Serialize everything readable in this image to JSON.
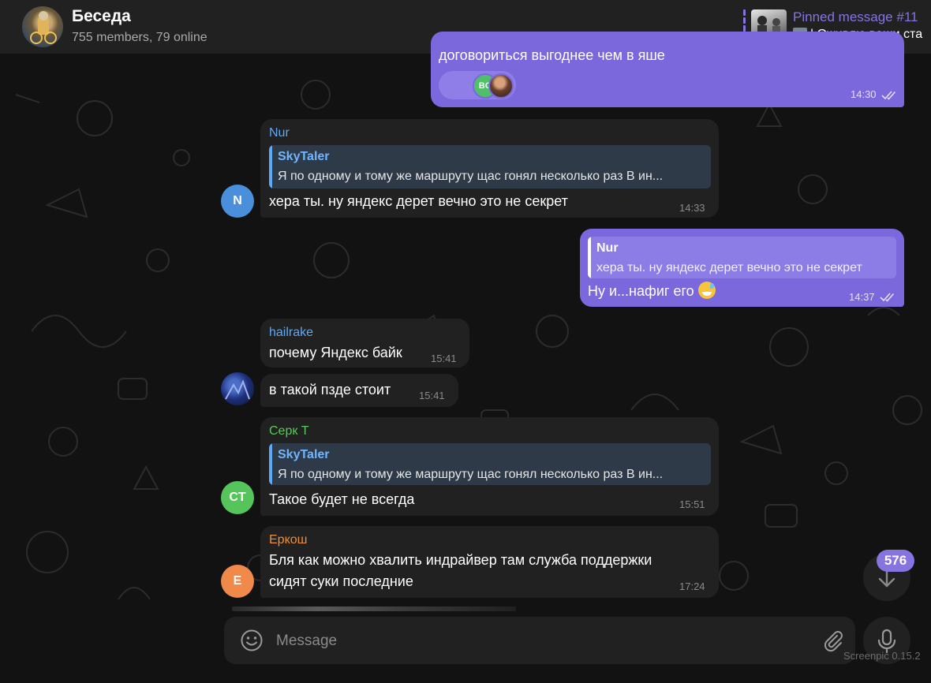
{
  "header": {
    "title": "Беседа",
    "subtitle": "755 members, 79 online",
    "pinned_title": "Pinned message #11",
    "pinned_text": "| Оживлю ваши ста"
  },
  "messages": [
    {
      "id": "m1",
      "direction": "out",
      "text": "договориться выгоднее чем в яше",
      "time": "14:30",
      "reactions": [
        {
          "label": "BG",
          "color": "#4fbf6a"
        },
        {
          "label": "",
          "type": "photo"
        }
      ]
    },
    {
      "id": "m2",
      "direction": "in",
      "sender": "Nur",
      "sender_color": "#5fa8f5",
      "avatar_initial": "N",
      "avatar_color": "#4a8fdc",
      "reply_name": "SkyTaler",
      "reply_text": "Я по одному и тому же маршруту щас гонял несколько раз В ин...",
      "text": "хера ты. ну яндекс дерет вечно это не секрет",
      "time": "14:33"
    },
    {
      "id": "m3",
      "direction": "out",
      "reply_name": "Nur",
      "reply_text": "хера ты. ну яндекс дерет вечно это не секрет",
      "text": "Ну и...нафиг его",
      "time": "14:37"
    },
    {
      "id": "m4",
      "direction": "in",
      "sender": "hailrake",
      "sender_color": "#5fa8f5",
      "text": "почему Яндекс байк",
      "time": "15:41"
    },
    {
      "id": "m5",
      "direction": "in",
      "text": "в такой пзде стоит",
      "time": "15:41"
    },
    {
      "id": "m6",
      "direction": "in",
      "sender": "Серк Т",
      "sender_color": "#59c85a",
      "avatar_initial": "CT",
      "avatar_color": "#54c45b",
      "reply_name": "SkyTaler",
      "reply_text": "Я по одному и тому же маршруту щас гонял несколько раз В ин...",
      "text": "Такое будет не всегда",
      "time": "15:51"
    },
    {
      "id": "m7",
      "direction": "in",
      "sender": "Еркош",
      "sender_color": "#f08f3a",
      "avatar_initial": "E",
      "avatar_color": "#f0894a",
      "text_line1": "Бля как можно хвалить индрайвер там служба поддержки",
      "text_line2": "сидят суки последние",
      "time": "17:24"
    }
  ],
  "scroll": {
    "unread_count": "576"
  },
  "composer": {
    "placeholder": "Message"
  },
  "watermark": "Screenpic 0.15.2",
  "colors": {
    "accent": "#8774e1",
    "outgoing": "#7a68dc",
    "incoming": "#212121",
    "background": "#121212"
  },
  "icons": [
    "emoji-icon",
    "attach-icon",
    "mic-icon",
    "chevron-down-icon",
    "double-check-icon"
  ]
}
